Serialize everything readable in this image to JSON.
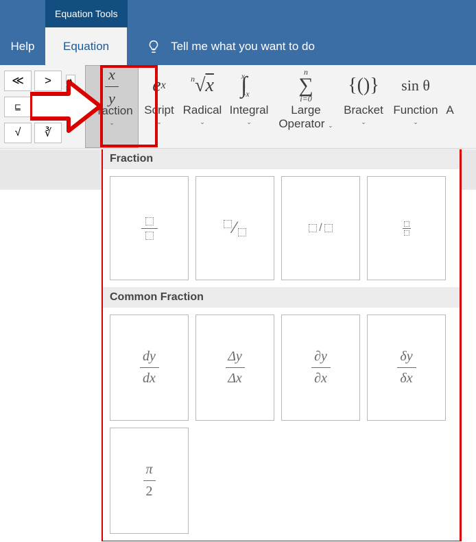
{
  "title_tab": "Equation Tools",
  "tabs": {
    "help": "Help",
    "equation": "Equation"
  },
  "tellme": "Tell me what you want to do",
  "ribbon": {
    "fraction": "Fraction",
    "script": "Script",
    "radical": "Radical",
    "integral": "Integral",
    "large_operator_1": "Large",
    "large_operator_2": "Operator",
    "bracket": "Bracket",
    "function": "Function",
    "accent_initial": "A"
  },
  "gallery": {
    "section_fraction": "Fraction",
    "section_common": "Common Fraction",
    "common": {
      "dydx_top": "dy",
      "dydx_bot": "dx",
      "DyDx_top": "Δy",
      "DyDx_bot": "Δx",
      "partial_top": "∂y",
      "partial_bot": "∂x",
      "delta_top": "δy",
      "delta_bot": "δx",
      "pi2_top": "π",
      "pi2_bot": "2"
    }
  }
}
